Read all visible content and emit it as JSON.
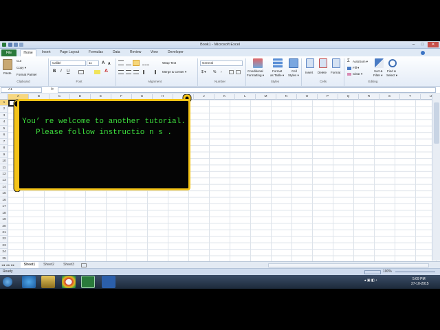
{
  "window": {
    "title": "Book1 - Microsoft Excel",
    "min": "–",
    "max": "□",
    "close": "✕"
  },
  "tabs": {
    "file": "File",
    "home": "Home",
    "insert": "Insert",
    "page_layout": "Page Layout",
    "formulas": "Formulas",
    "data": "Data",
    "review": "Review",
    "view": "View",
    "developer": "Developer"
  },
  "ribbon": {
    "clipboard": {
      "paste": "Paste",
      "cut": "Cut",
      "copy": "Copy ▾",
      "format_painter": "Format Painter",
      "label": "Clipboard"
    },
    "font": {
      "name": "Calibri",
      "size": "11",
      "grow": "A",
      "shrink": "A",
      "bold": "B",
      "italic": "I",
      "underline": "U",
      "color_glyph": "A",
      "label": "Font"
    },
    "alignment": {
      "wrap": "Wrap Text",
      "merge": "Merge & Center ▾",
      "label": "Alignment"
    },
    "number": {
      "format": "General",
      "currency": "$ ▾",
      "percent": "%",
      "comma": "›",
      "label": "Number"
    },
    "styles": {
      "conditional": "Conditional",
      "conditional2": "Formatting ▾",
      "table": "Format",
      "table2": "as Table ▾",
      "cell": "Cell",
      "cell2": "Styles ▾",
      "label": "Styles"
    },
    "cells": {
      "insert": "Insert",
      "delete": "Delete",
      "format": "Format",
      "label": "Cells"
    },
    "editing": {
      "autosum": "AutoSum ▾",
      "fill": "Fill ▾",
      "clear": "Clear ▾",
      "sort": "Sort &",
      "sort2": "Filter ▾",
      "find": "Find &",
      "find2": "Select ▾",
      "label": "Editing"
    }
  },
  "formula_bar": {
    "name_box": "A1",
    "fx": "fx",
    "value": ""
  },
  "columns": [
    "A",
    "B",
    "C",
    "D",
    "E",
    "F",
    "G",
    "H",
    "I",
    "J",
    "K",
    "L",
    "M",
    "N",
    "O",
    "P",
    "Q",
    "R",
    "S",
    "T",
    "U"
  ],
  "rows": [
    "1",
    "2",
    "3",
    "4",
    "5",
    "6",
    "7",
    "8",
    "9",
    "10",
    "11",
    "12",
    "13",
    "14",
    "15",
    "16",
    "17",
    "18",
    "19",
    "20",
    "21",
    "22",
    "23",
    "24",
    "25"
  ],
  "banner": {
    "line1": "You’ re welcome to another tutorial.",
    "line2": "Please follow instructio n s ."
  },
  "sheets": [
    "Sheet1",
    "Sheet2",
    "Sheet3"
  ],
  "status": {
    "ready": "Ready",
    "zoom": "100%"
  },
  "tray": {
    "time": "5:09 PM",
    "date": "27-10-2015"
  },
  "colors": {
    "banner_border": "#f4c318",
    "banner_text": "#3ddc3d",
    "file_tab": "#2a7a3b"
  }
}
